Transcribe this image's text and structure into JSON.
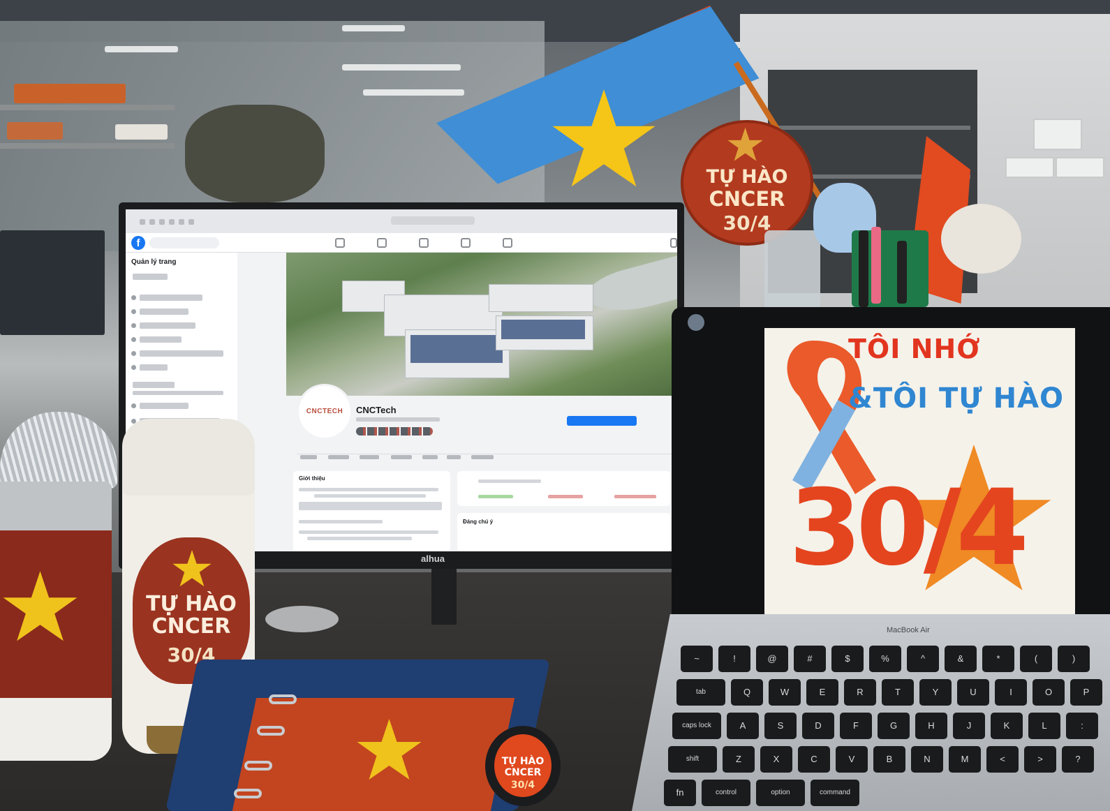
{
  "photo": {
    "description_colors": {
      "flag_red": "#e2471f",
      "flag_blue": "#3f8ed6",
      "star_yellow": "#f5c518",
      "facebook_blue": "#1877f2"
    }
  },
  "monitor": {
    "brand": "alhua",
    "facebook": {
      "logo": "f",
      "sidebar_title": "Quản lý trang",
      "page_name": "CNCTech",
      "profile_logo_text": "CNCTECH",
      "intro_title": "Giới thiệu",
      "featured_title": "Đáng chú ý"
    }
  },
  "flag_sign": {
    "line1": "TỰ HÀO",
    "line2": "CNCER",
    "line3": "30/4"
  },
  "laptop": {
    "model": "MacBook Air",
    "poster": {
      "line1": "TÔI NHỚ",
      "line2": "&TÔI TỰ HÀO",
      "number": "30/4"
    },
    "keys_row1": [
      "~",
      "!",
      "@",
      "#",
      "$",
      "%",
      "^",
      "&",
      "*",
      "(",
      ")"
    ],
    "keys_row2": [
      "tab",
      "Q",
      "W",
      "E",
      "R",
      "T",
      "Y",
      "U",
      "I",
      "O",
      "P"
    ],
    "keys_row3": [
      "caps lock",
      "A",
      "S",
      "D",
      "F",
      "G",
      "H",
      "J",
      "K",
      "L",
      ":"
    ],
    "keys_row4": [
      "shift",
      "Z",
      "X",
      "C",
      "V",
      "B",
      "N",
      "M",
      "<",
      ">",
      "?"
    ],
    "keys_row5": [
      "fn",
      "control",
      "option",
      "command"
    ]
  },
  "tumbler": {
    "line1": "TỰ HÀO",
    "line2": "CNCER",
    "line3": "30/4"
  },
  "badge": {
    "line1": "TỰ HÀO",
    "line2": "CNCER",
    "line3": "30/4"
  }
}
